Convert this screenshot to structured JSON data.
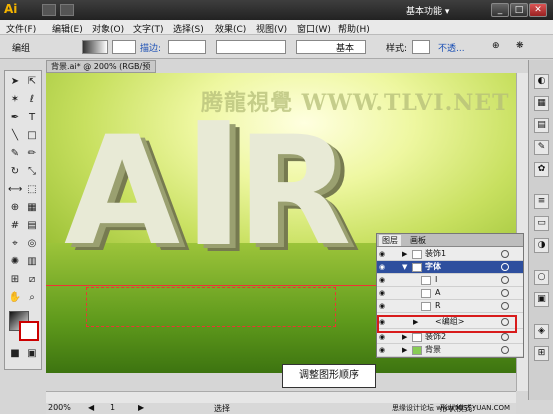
{
  "titlebar": {
    "logo": "Ai",
    "workspace": "基本功能 ▾",
    "min": "_",
    "max": "□",
    "close": "✕"
  },
  "menu": [
    "文件(F)",
    "编辑(E)",
    "对象(O)",
    "文字(T)",
    "选择(S)",
    "效果(C)",
    "视图(V)",
    "窗口(W)",
    "帮助(H)"
  ],
  "controlbar": {
    "group_label": "编组",
    "stroke_label": "描边:",
    "style_label": "基本",
    "style_text": "样式:",
    "opacity_label": "不透..."
  },
  "document": {
    "tab": "背景.ai* @ 200% (RGB/预览)",
    "watermark": "腾龍視覺 WWW.TLVI.NET",
    "letters": "AIR"
  },
  "layers": {
    "tabs": [
      "图层",
      "画板"
    ],
    "rows": [
      {
        "label": "装饰1"
      },
      {
        "label": "字体"
      },
      {
        "label": "I"
      },
      {
        "label": "A"
      },
      {
        "label": "R"
      },
      {
        "label": "<编组>"
      },
      {
        "label": "装饰2"
      },
      {
        "label": "背景"
      }
    ]
  },
  "callout": "调整图形顺序",
  "status": {
    "zoom": "200%",
    "page": "1",
    "mode": "选择"
  },
  "footer_hint": "形状模式:",
  "footer_site": "思缘设计论坛 www.MISSYUAN.COM"
}
